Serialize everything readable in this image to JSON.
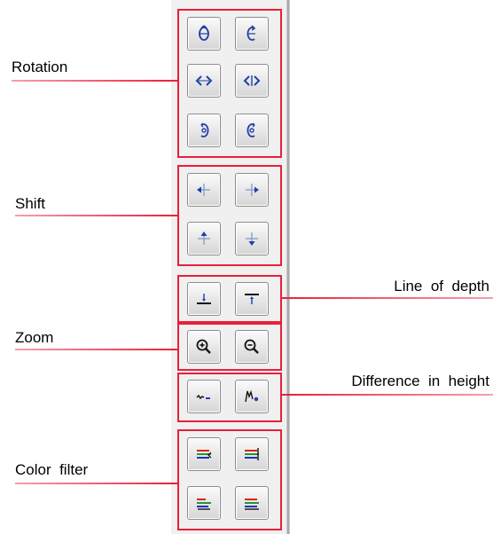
{
  "labels": {
    "rotation": "Rotation",
    "shift": "Shift",
    "zoom": "Zoom",
    "color_filter": "Color  filter",
    "line_of_depth": "Line  of  depth",
    "difference_in_height": "Difference  in  height"
  },
  "colors": {
    "accent_red": "#e8203a",
    "icon_blue": "#1f3fa8",
    "filter_red": "#e02020",
    "filter_green": "#1f9a2a",
    "filter_blue": "#2030c0"
  },
  "groups": [
    {
      "name": "rotation",
      "buttons": [
        "rotate-up-icon",
        "rotate-down-icon",
        "rotate-left-icon",
        "rotate-right-icon",
        "rotate-ccw-icon",
        "rotate-cw-icon"
      ]
    },
    {
      "name": "shift",
      "buttons": [
        "shift-left-icon",
        "shift-right-icon",
        "shift-up-icon",
        "shift-down-icon"
      ]
    },
    {
      "name": "line-of-depth",
      "buttons": [
        "depth-line-down-icon",
        "depth-line-up-icon"
      ]
    },
    {
      "name": "zoom",
      "buttons": [
        "zoom-in-icon",
        "zoom-out-icon"
      ]
    },
    {
      "name": "difference-in-height",
      "buttons": [
        "height-low-icon",
        "height-high-icon"
      ]
    },
    {
      "name": "color-filter",
      "buttons": [
        "color-filter-1-icon",
        "color-filter-2-icon",
        "color-filter-3-icon",
        "color-filter-4-icon"
      ]
    }
  ]
}
